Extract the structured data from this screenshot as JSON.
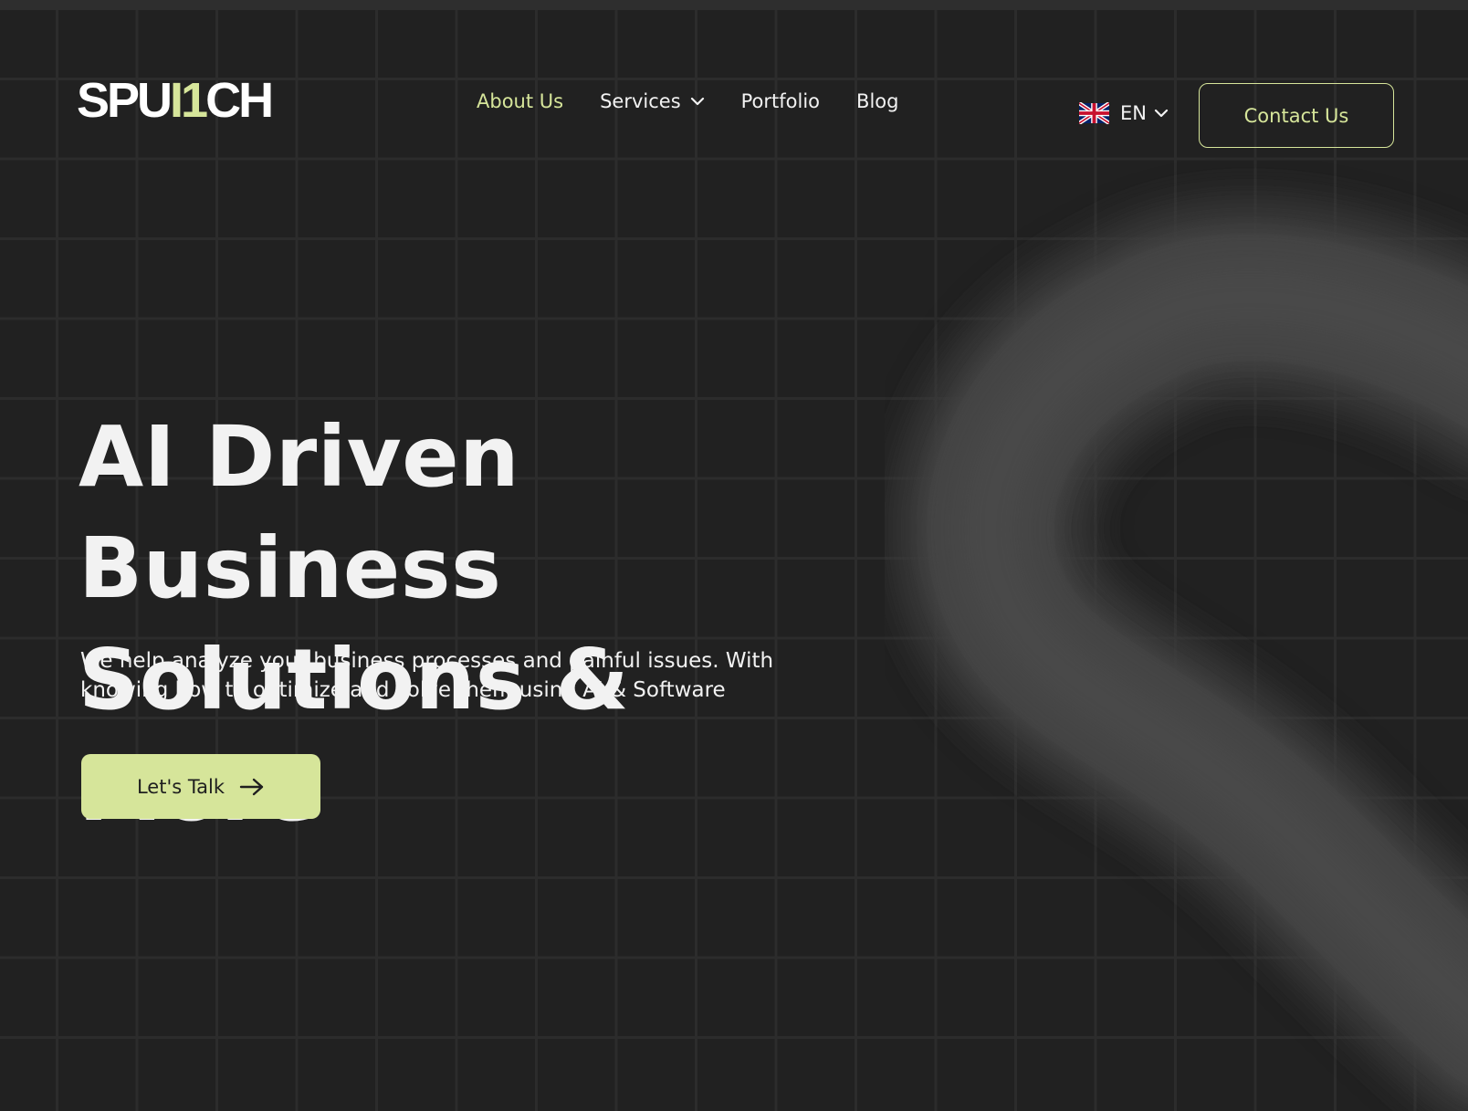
{
  "brand": {
    "logo_left": "SPU",
    "logo_accent": "I1",
    "logo_right": "CH",
    "accent_color": "#d6e59a",
    "background_color": "#212121"
  },
  "nav": {
    "items": [
      {
        "label": "About Us",
        "active": true
      },
      {
        "label": "Services",
        "dropdown": true
      },
      {
        "label": "Portfolio"
      },
      {
        "label": "Blog"
      }
    ]
  },
  "language": {
    "code": "EN",
    "flag_icon": "uk-flag-icon"
  },
  "header": {
    "contact_label": "Contact Us"
  },
  "hero": {
    "headline_line1": "AI Driven Business",
    "headline_line2": "Solutions & More",
    "subtext": "We help analyze your business processes and painful issues. With knowing how to optimize and solve them using AI & Software",
    "cta_label": "Let's Talk",
    "cta_icon": "arrow-right-icon"
  }
}
